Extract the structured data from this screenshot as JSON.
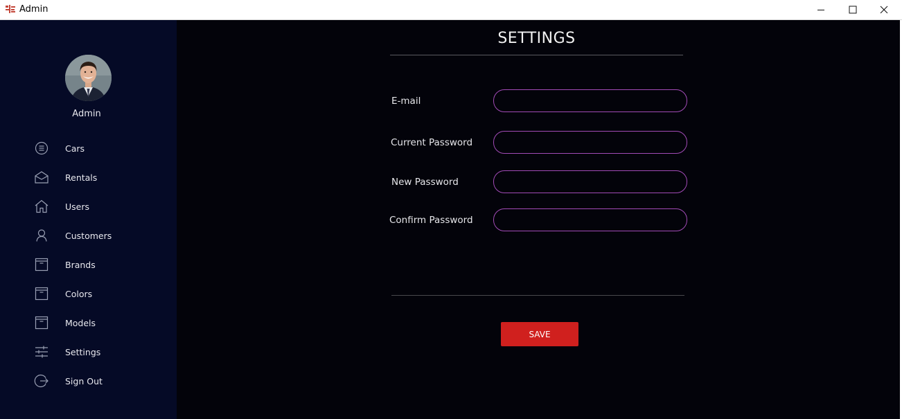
{
  "window": {
    "title": "Admin",
    "minimize_icon": "minimize-icon",
    "maximize_icon": "maximize-icon",
    "close_icon": "close-icon"
  },
  "sidebar": {
    "user_name": "Admin",
    "items": [
      {
        "label": "Cars",
        "icon": "list-circle-icon"
      },
      {
        "label": "Rentals",
        "icon": "envelope-icon"
      },
      {
        "label": "Users",
        "icon": "home-icon"
      },
      {
        "label": "Customers",
        "icon": "person-icon"
      },
      {
        "label": "Brands",
        "icon": "archive-box-icon"
      },
      {
        "label": "Colors",
        "icon": "archive-box-icon"
      },
      {
        "label": "Models",
        "icon": "archive-box-icon"
      },
      {
        "label": "Settings",
        "icon": "sliders-icon"
      },
      {
        "label": "Sign Out",
        "icon": "sign-out-icon"
      }
    ]
  },
  "settings": {
    "title": "SETTINGS",
    "fields": [
      {
        "label": "E-mail",
        "value": ""
      },
      {
        "label": "Current Password",
        "value": ""
      },
      {
        "label": "New Password",
        "value": ""
      },
      {
        "label": "Confirm Password",
        "value": ""
      }
    ],
    "save_label": "SAVE"
  },
  "colors": {
    "sidebar_bg": "#050a26",
    "main_bg": "#03030a",
    "input_border": "#a24bb7",
    "save_button": "#d0201e"
  }
}
